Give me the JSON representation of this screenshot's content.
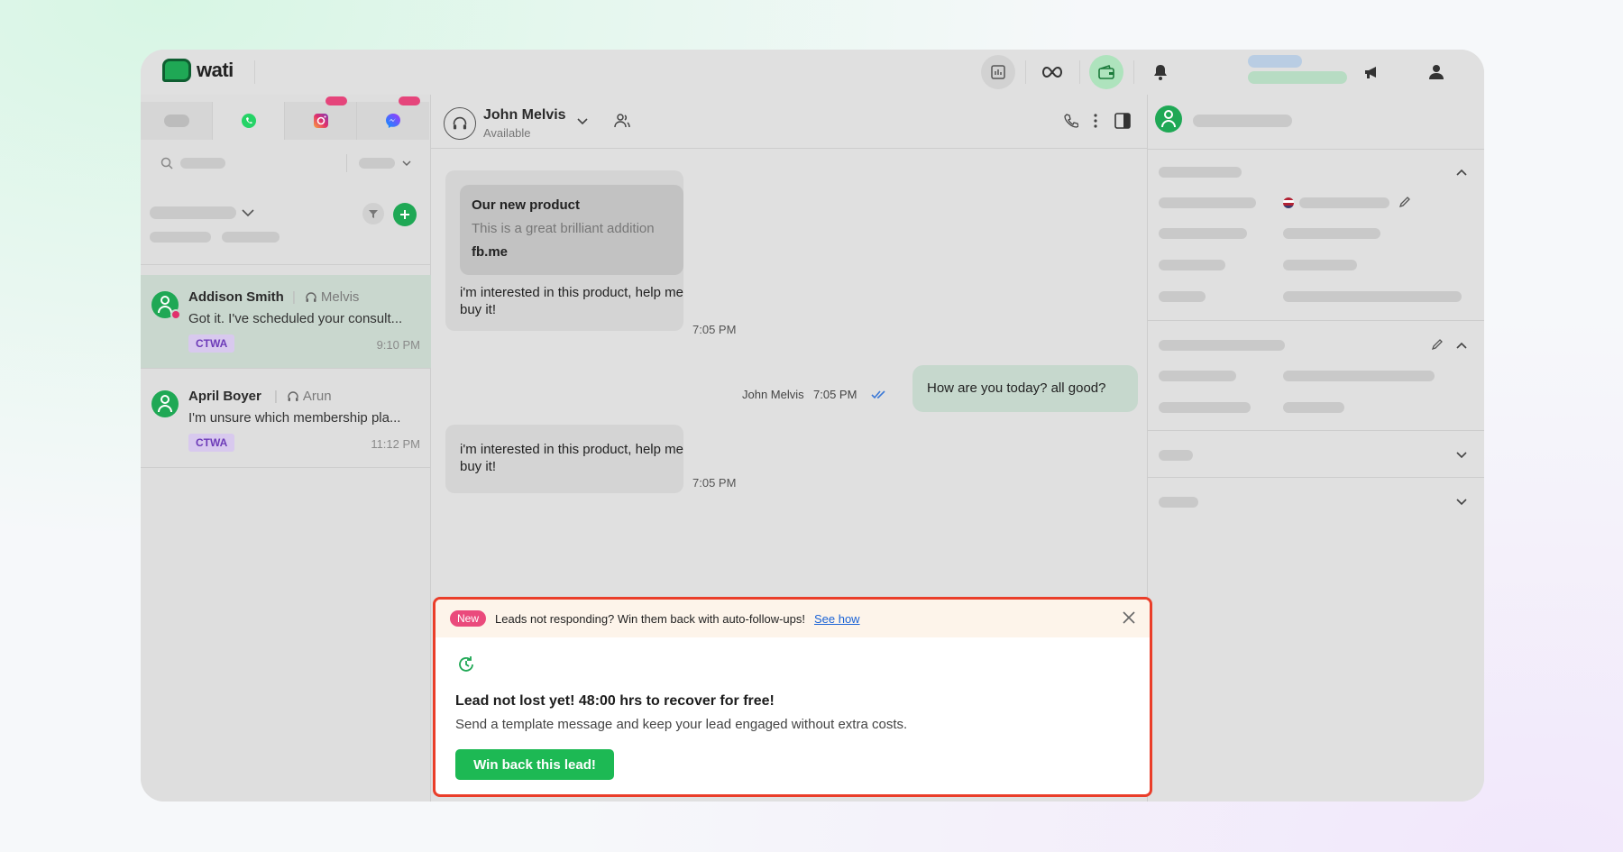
{
  "app": {
    "logo_text": "wati"
  },
  "colors": {
    "brand_green": "#1fa855",
    "accent_pink": "#e5457b",
    "alert_red": "#ea3e2a",
    "button_green": "#1db954",
    "link_blue": "#1a63d6"
  },
  "channels": [
    "all",
    "whatsapp-icon",
    "instagram-icon",
    "messenger-icon"
  ],
  "conversations": [
    {
      "name": "Addison Smith",
      "agent": "Melvis",
      "message": "Got it. I've scheduled your consult...",
      "tag": "CTWA",
      "time": "9:10 PM"
    },
    {
      "name": "April Boyer",
      "agent": "Arun",
      "message": "I'm unsure which membership pla...",
      "tag": "CTWA",
      "time": "11:12 PM"
    }
  ],
  "chat": {
    "contact_name": "John Melvis",
    "contact_status": "Available",
    "messages": [
      {
        "card_title": "Our new product",
        "card_subtitle": "This is a great brilliant addition",
        "card_link": "fb.me",
        "text": "i'm interested in this product, help me buy it!",
        "time": "7:05 PM"
      },
      {
        "sender": "John Melvis",
        "time": "7:05 PM",
        "text": "How are you today? all good?"
      },
      {
        "text": "i'm interested in this product, help me buy it!",
        "time": "7:05 PM"
      }
    ]
  },
  "popup": {
    "badge": "New",
    "banner_text": "Leads not responding? Win them back with auto-follow-ups!",
    "banner_link": "See how",
    "title": "Lead not lost yet! 48:00 hrs to recover for free!",
    "description": "Send a template message and keep your lead engaged without extra costs.",
    "button": "Win back this lead!"
  }
}
